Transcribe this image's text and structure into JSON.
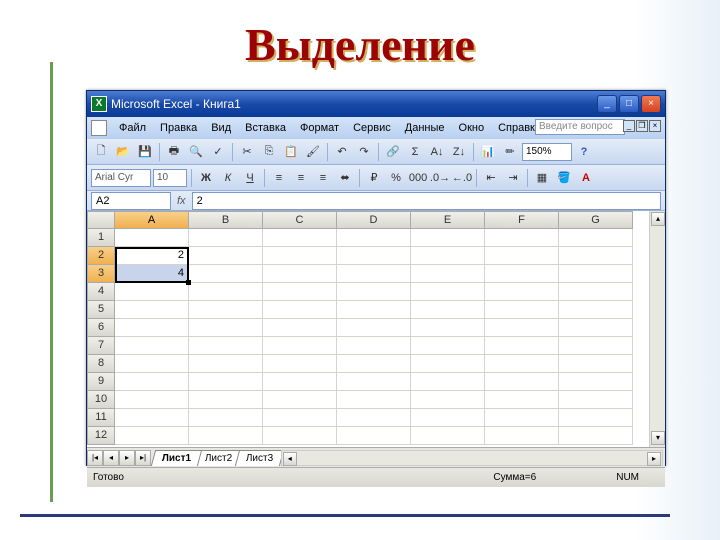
{
  "slide": {
    "title": "Выделение"
  },
  "window": {
    "title": "Microsoft Excel - Книга1"
  },
  "menu": [
    "Файл",
    "Правка",
    "Вид",
    "Вставка",
    "Формат",
    "Сервис",
    "Данные",
    "Окно",
    "Справка"
  ],
  "help_box": {
    "placeholder": "Введите вопрос"
  },
  "toolbar": {
    "zoom": "150%",
    "font": "Arial Cyr",
    "font_size": "10"
  },
  "formula_bar": {
    "name_box": "A2",
    "value": "2"
  },
  "grid": {
    "columns": [
      "A",
      "B",
      "C",
      "D",
      "E",
      "F",
      "G"
    ],
    "rows": [
      1,
      2,
      3,
      4,
      5,
      6,
      7,
      8,
      9,
      10,
      11,
      12
    ],
    "cells": {
      "A2": "2",
      "A3": "4"
    },
    "selected_rows": [
      2,
      3
    ],
    "active_cell": "A2"
  },
  "sheets": [
    "Лист1",
    "Лист2",
    "Лист3"
  ],
  "status": {
    "ready": "Готово",
    "sum": "Сумма=6",
    "num": "NUM"
  },
  "colors": {
    "accent": "#1a4aa8",
    "title": "#9c0404",
    "sel_header": "#f0b050",
    "sel_fill": "#c8d4ec"
  }
}
